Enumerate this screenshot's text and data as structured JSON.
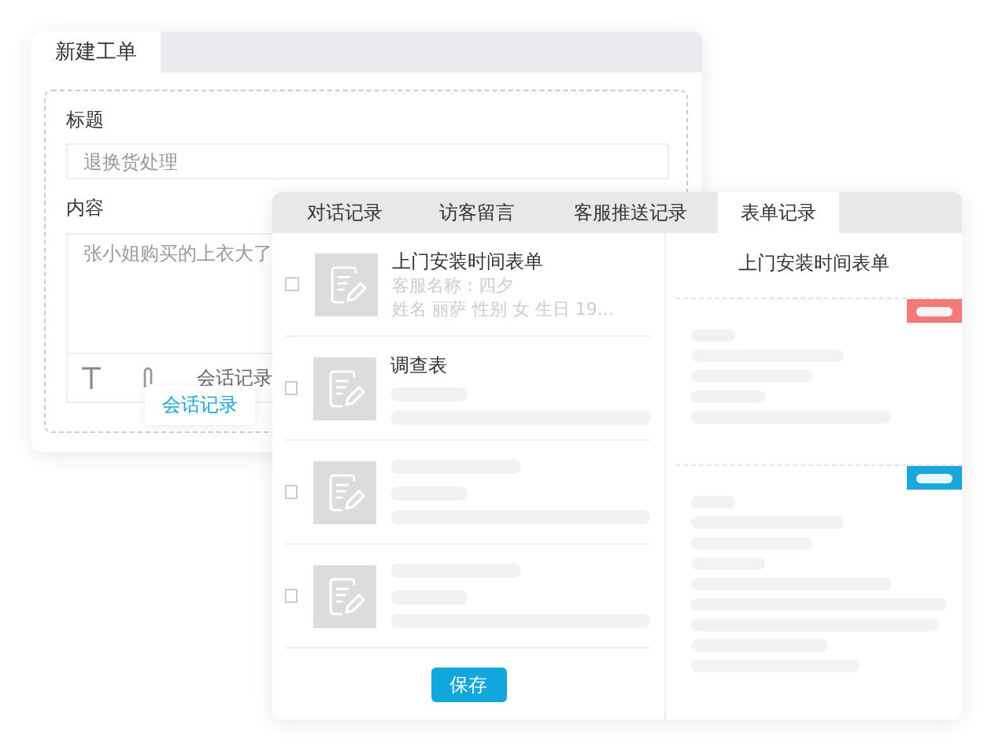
{
  "ticket_window": {
    "tab": "新建工单",
    "title_label": "标题",
    "title_field": {
      "placeholder": "退换货处理"
    },
    "content_label": "内容",
    "content_field": {
      "value": "张小姐购买的上衣大了"
    },
    "toolbar_text": "会话记录",
    "tooltip": "会话记录"
  },
  "records_window": {
    "tabs": [
      {
        "label": "对话记录",
        "selected": false
      },
      {
        "label": "访客留言",
        "selected": false
      },
      {
        "label": "客服推送记录",
        "selected": false
      },
      {
        "label": "表单记录",
        "selected": true
      }
    ],
    "forms": [
      {
        "kind": "filled",
        "checked": false,
        "title": "上门安装时间表单",
        "lines": [
          "客服名称：四夕",
          "姓名 丽萨  性别 女  生日 19..."
        ]
      },
      {
        "kind": "titled",
        "checked": false,
        "title": "调查表"
      },
      {
        "kind": "blank",
        "checked": false
      },
      {
        "kind": "blank",
        "checked": false
      }
    ],
    "save_button": "保存",
    "preview": {
      "title": "上门安装时间表单",
      "sections": [
        {
          "color": "#f47a7a"
        },
        {
          "color": "#1aa8dc"
        }
      ]
    }
  }
}
